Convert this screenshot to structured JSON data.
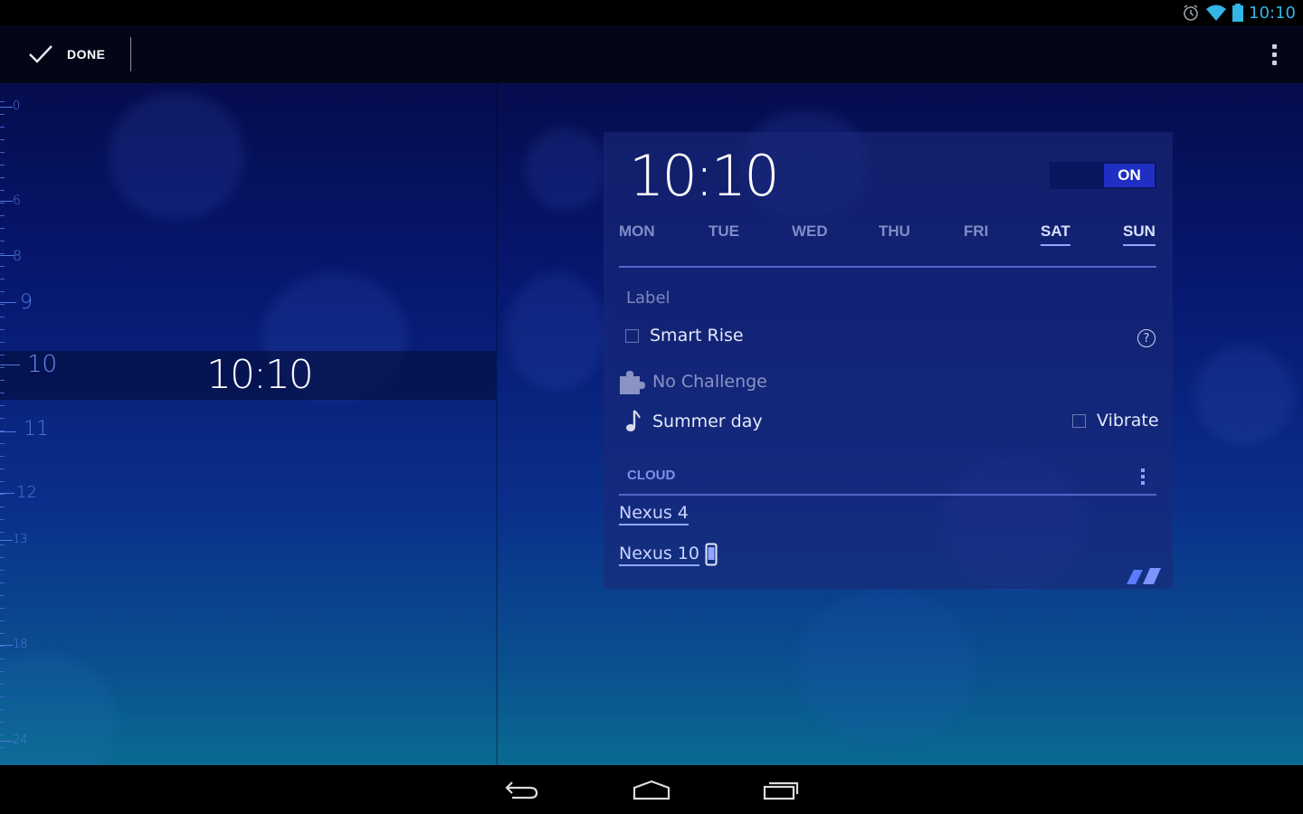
{
  "status_bar": {
    "time": "10:10",
    "icons": [
      "alarm-icon",
      "wifi-icon",
      "battery-icon"
    ]
  },
  "action_bar": {
    "done_label": "DONE",
    "done_icon": "checkmark-icon",
    "overflow_icon": "overflow-menu-icon"
  },
  "timeline": {
    "hour_labels": [
      "0",
      "6",
      "8",
      "9",
      "10",
      "11",
      "12",
      "13",
      "18",
      "24"
    ],
    "selected_time": "10:10"
  },
  "alarm": {
    "time": "10:10",
    "toggle_label": "ON",
    "days": [
      {
        "label": "MON",
        "active": false
      },
      {
        "label": "TUE",
        "active": false
      },
      {
        "label": "WED",
        "active": false
      },
      {
        "label": "THU",
        "active": false
      },
      {
        "label": "FRI",
        "active": false
      },
      {
        "label": "SAT",
        "active": true
      },
      {
        "label": "SUN",
        "active": true
      }
    ],
    "label_placeholder": "Label",
    "smart_rise_label": "Smart Rise",
    "challenge_label": "No Challenge",
    "ringtone_label": "Summer day",
    "vibrate_label": "Vibrate",
    "cloud_section_title": "CLOUD",
    "devices": [
      "Nexus 4",
      "Nexus 10"
    ]
  },
  "colors": {
    "accent": "#33b5e5",
    "active_day": "#d8e0ff",
    "inactive_day": "#7f8dc6",
    "toggle_on": "#1f2fc4"
  }
}
